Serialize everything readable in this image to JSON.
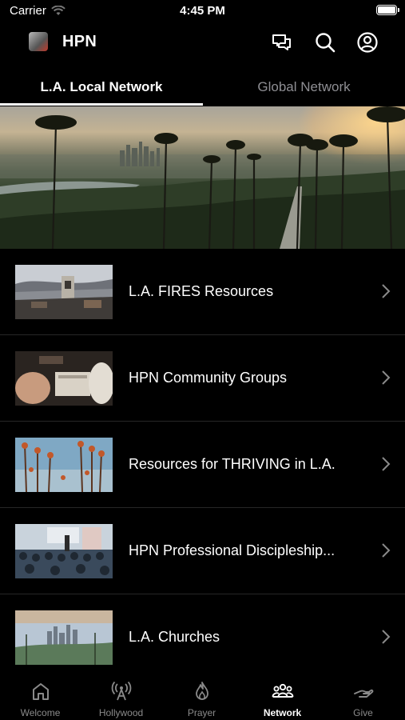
{
  "status": {
    "carrier": "Carrier",
    "time": "4:45 PM"
  },
  "header": {
    "title": "HPN",
    "icons": [
      "chat-icon",
      "search-icon",
      "profile-icon"
    ]
  },
  "tabs": [
    {
      "label": "L.A. Local Network",
      "active": true
    },
    {
      "label": "Global Network",
      "active": false
    }
  ],
  "list": {
    "items": [
      {
        "label": "L.A. FIRES Resources"
      },
      {
        "label": "HPN Community Groups"
      },
      {
        "label": "Resources for THRIVING in L.A."
      },
      {
        "label": "HPN Professional Discipleship..."
      },
      {
        "label": "L.A. Churches"
      }
    ]
  },
  "tabbar": {
    "items": [
      {
        "label": "Welcome",
        "icon": "home-icon"
      },
      {
        "label": "Hollywood",
        "icon": "broadcast-icon"
      },
      {
        "label": "Prayer",
        "icon": "flame-icon"
      },
      {
        "label": "Network",
        "icon": "people-icon",
        "active": true
      },
      {
        "label": "Give",
        "icon": "give-icon"
      }
    ]
  },
  "colors": {
    "background": "#000000",
    "active": "#ffffff",
    "inactive": "#8a8a8a"
  }
}
